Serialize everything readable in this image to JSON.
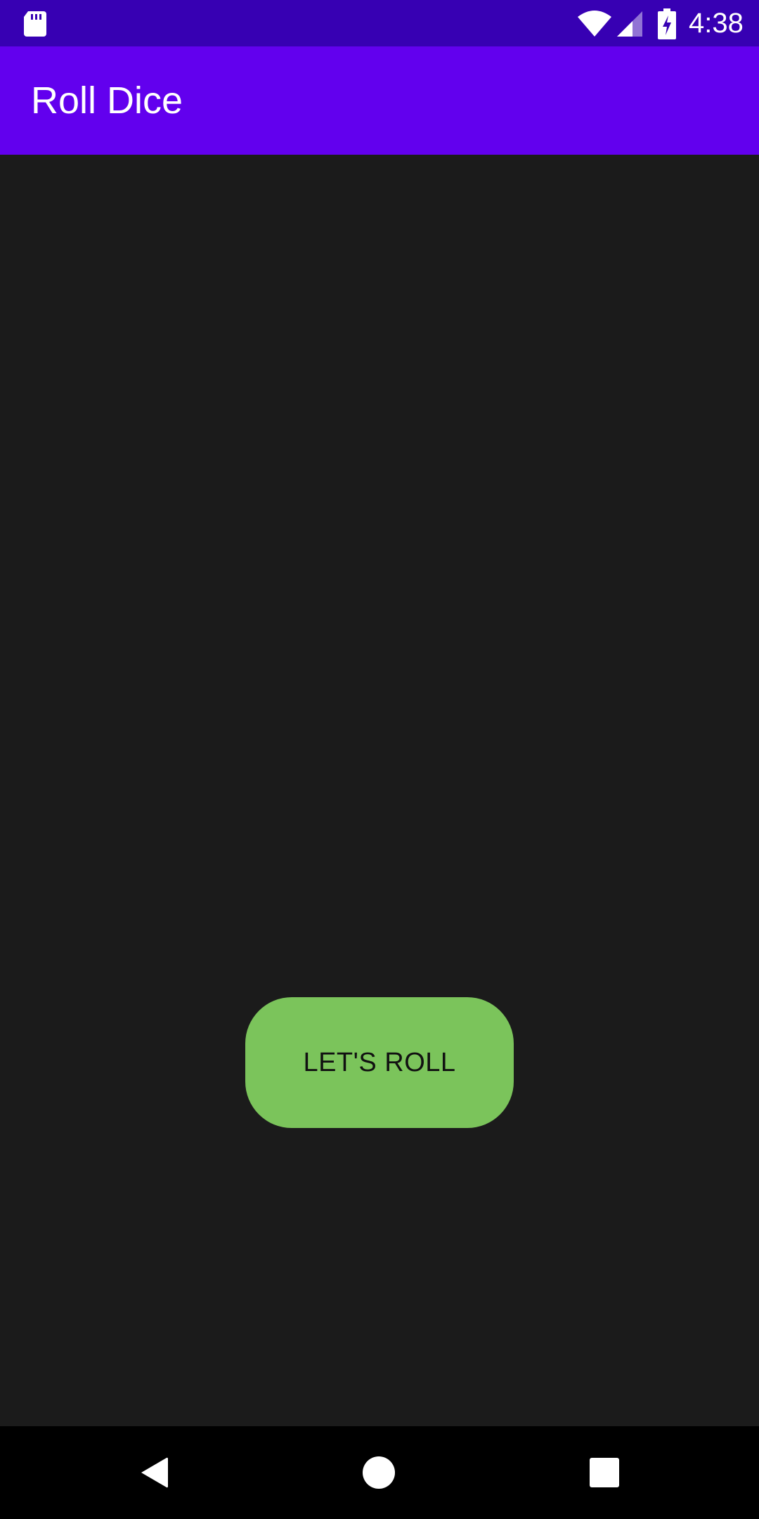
{
  "status_bar": {
    "time": "4:38",
    "icons": [
      "sd-card-icon",
      "wifi-icon",
      "cellular-signal-icon",
      "battery-charging-icon"
    ]
  },
  "app_bar": {
    "title": "Roll Dice",
    "color": "#6200ee"
  },
  "main": {
    "roll_button_label": "LET'S ROLL",
    "roll_button_color": "#7bc45b",
    "background_color": "#1b1b1b"
  },
  "nav_bar": {
    "buttons": [
      "back-icon",
      "home-icon",
      "recents-icon"
    ]
  }
}
